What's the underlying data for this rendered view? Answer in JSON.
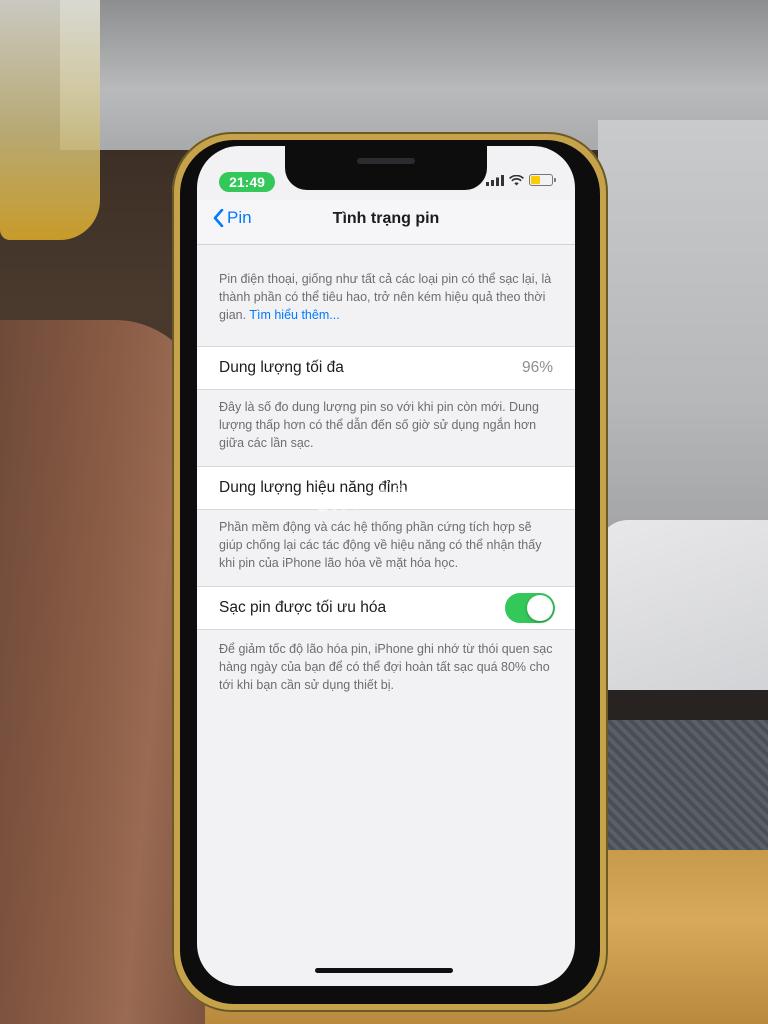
{
  "status_bar": {
    "time": "21:49",
    "wifi_icon": "wifi-icon",
    "signal_icon": "cellular-signal-icon",
    "battery_icon": "battery-icon"
  },
  "nav": {
    "back_label": "Pin",
    "title": "Tình trạng pin"
  },
  "intro": {
    "text": "Pin điện thoại, giống như tất cả các loại pin có thể sạc lại, là thành phần có thể tiêu hao, trở nên kém hiệu quả theo thời gian.",
    "link": "Tìm hiểu thêm..."
  },
  "max_capacity": {
    "label": "Dung lượng tối đa",
    "value": "96%",
    "footer": "Đây là số đo dung lượng pin so với khi pin còn mới. Dung lượng thấp hơn có thể dẫn đến số giờ sử dụng ngắn hơn giữa các lần sạc."
  },
  "peak_performance": {
    "label": "Dung lượng hiệu năng đỉnh",
    "footer": "Phần mềm động và các hệ thống phần cứng tích hợp sẽ giúp chống lại các tác động về hiệu năng có thể nhận thấy khi pin của iPhone lão hóa về mặt hóa học."
  },
  "optimized_charging": {
    "label": "Sạc pin được tối ưu hóa",
    "enabled": true,
    "footer": "Để giảm tốc độ lão hóa pin, iPhone ghi nhớ từ thói quen sạc hàng ngày của bạn để có thể đợi hoàn tất sạc quá 80% cho tới khi bạn cần sử dụng thiết bị."
  },
  "watermark": "cho TỐT",
  "colors": {
    "accent": "#007aff",
    "toggle_on": "#34c759",
    "time_pill": "#34c759"
  }
}
